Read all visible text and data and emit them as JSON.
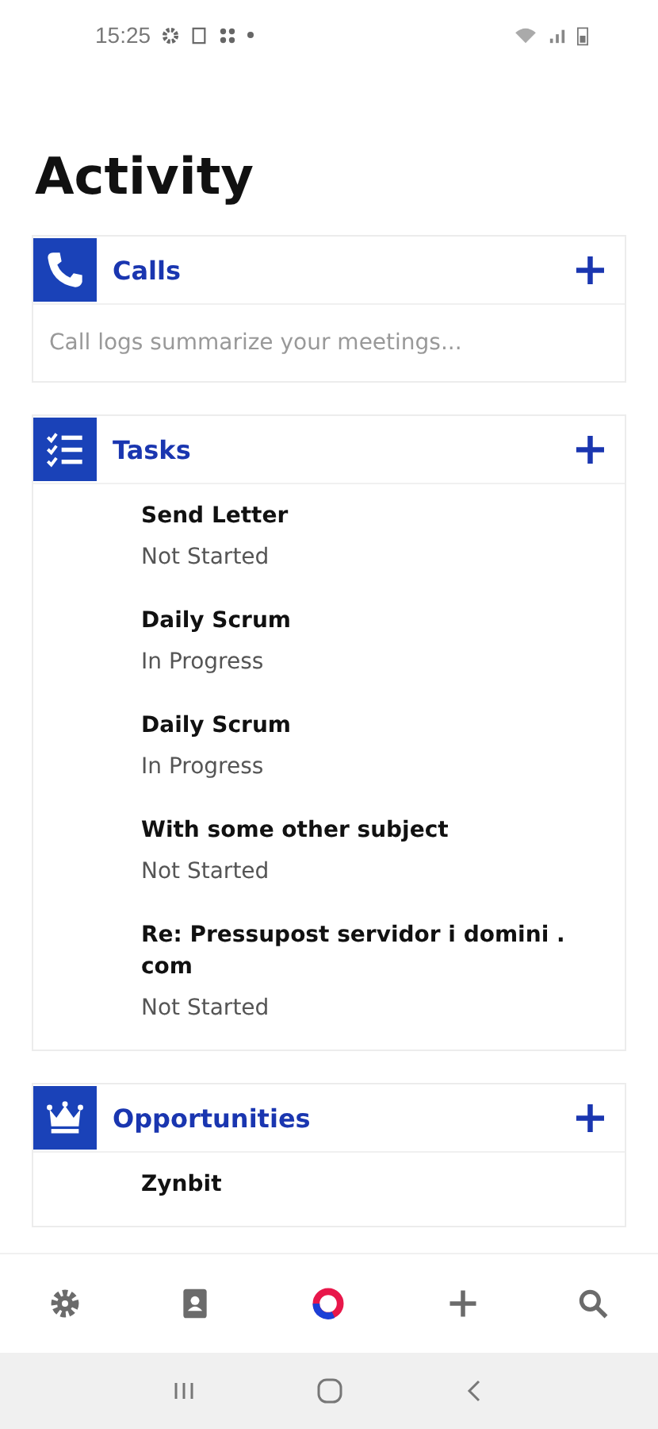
{
  "status_bar": {
    "time": "15:25"
  },
  "title": "Activity",
  "sections": [
    {
      "kind": "calls",
      "title": "Calls",
      "add": "+",
      "empty_text": "Call logs summarize your meetings..."
    },
    {
      "kind": "tasks",
      "title": "Tasks",
      "add": "+",
      "items": [
        {
          "title": "Send Letter",
          "status": "Not Started"
        },
        {
          "title": "Daily Scrum",
          "status": "In Progress"
        },
        {
          "title": "Daily Scrum",
          "status": "In Progress"
        },
        {
          "title": "With some other subject",
          "status": "Not Started"
        },
        {
          "title": "Re: Pressupost servidor i domini . com",
          "status": "Not Started"
        }
      ]
    },
    {
      "kind": "opportunities",
      "title": "Opportunities",
      "add": "+",
      "items": [
        {
          "title": "Zynbit"
        }
      ]
    }
  ],
  "bottom_nav": [
    {
      "kind": "settings",
      "selected": false
    },
    {
      "kind": "contacts",
      "selected": false
    },
    {
      "kind": "activity",
      "selected": true
    },
    {
      "kind": "add",
      "selected": false
    },
    {
      "kind": "search",
      "selected": false
    }
  ]
}
